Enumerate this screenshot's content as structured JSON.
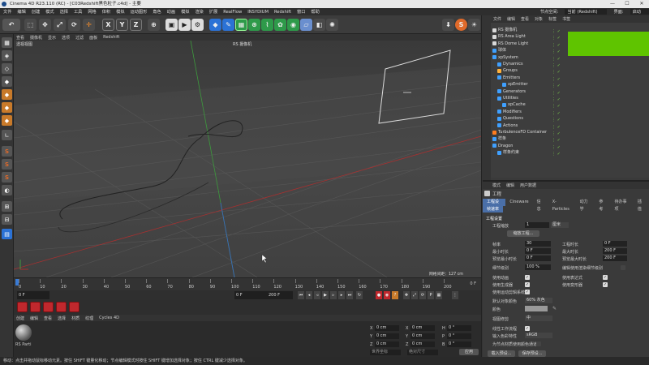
{
  "window": {
    "title": "Cinema 4D R23.110 (RC) - [C03Redshift黑色粒子.c4d] - 主要",
    "min": "—",
    "max": "☐",
    "close": "✕"
  },
  "menubar": {
    "items": [
      "文件",
      "编辑",
      "创建",
      "模式",
      "选择",
      "工具",
      "网格",
      "体积",
      "模拟",
      "运动图形",
      "角色",
      "动画",
      "模拟",
      "渲染",
      "扩展",
      "RealFlow",
      "INSYDIUM",
      "Redshift",
      "窗口",
      "帮助"
    ],
    "right": [
      "节点空间:",
      "当前 (Redshift)",
      "界面:",
      "启动"
    ]
  },
  "toolbar": {
    "xyz": [
      "X",
      "Y",
      "Z"
    ]
  },
  "viewport": {
    "menu": [
      "查看",
      "摄像机",
      "显示",
      "选项",
      "过滤",
      "面板",
      "Redshift"
    ],
    "label": "透视视图",
    "camera": "RS 摄像机",
    "grid": "网格间距：127 cm"
  },
  "timeline": {
    "ticks": [
      "0",
      "10",
      "20",
      "30",
      "40",
      "50",
      "60",
      "70",
      "80",
      "90",
      "100",
      "110",
      "120",
      "130",
      "140",
      "150",
      "160",
      "170",
      "180",
      "190",
      "200"
    ],
    "end_label": "0 F"
  },
  "transport": {
    "current": "0 F",
    "start": "0 F",
    "end": "200 F",
    "end2": "200 F"
  },
  "material": {
    "menu": [
      "创建",
      "编辑",
      "查看",
      "选择",
      "材质",
      "纹理",
      "Cycles 4D"
    ],
    "name": "RS Parti"
  },
  "coords": {
    "labels": [
      "X",
      "Y",
      "Z"
    ],
    "values": [
      "0 cm",
      "0 cm",
      "0 cm"
    ],
    "labels2": [
      "X",
      "Y",
      "Z"
    ],
    "values2": [
      "0 cm",
      "0 cm",
      "0 cm"
    ],
    "labels3": [
      "H",
      "P",
      "B"
    ],
    "values3": [
      "0 °",
      "0 °",
      "0 °"
    ],
    "mode1": "世界坐标",
    "mode2": "绝对尺寸",
    "apply": "应用"
  },
  "status": "移动：点击并拖动鼠标移动元素。按住 SHIFT 键量化移动；节点编辑模式时按住 SHIFT 键增加选择对象；按住 CTRL 键减少选择对象。",
  "object_manager": {
    "menu": [
      "文件",
      "编辑",
      "查看",
      "对象",
      "标签",
      "书签"
    ],
    "rows": [
      {
        "name": "RS 摄像机",
        "indent": 0,
        "color": "#d9d9d9"
      },
      {
        "name": "RS Area Light",
        "indent": 0,
        "color": "#d9d9d9"
      },
      {
        "name": "RS Dome Light",
        "indent": 0,
        "color": "#d9d9d9"
      },
      {
        "name": "球体",
        "indent": 0,
        "color": "#3fa0ff"
      },
      {
        "name": "xpSystem",
        "indent": 0,
        "color": "#3fa0ff"
      },
      {
        "name": "Dynamics",
        "indent": 1,
        "color": "#3fa0ff"
      },
      {
        "name": "Groups",
        "indent": 1,
        "color": "#ffb13b"
      },
      {
        "name": "Emitters",
        "indent": 1,
        "color": "#3fa0ff"
      },
      {
        "name": "xpEmitter",
        "indent": 2,
        "color": "#3fa0ff"
      },
      {
        "name": "Generators",
        "indent": 1,
        "color": "#3fa0ff"
      },
      {
        "name": "Utilities",
        "indent": 1,
        "color": "#3fa0ff"
      },
      {
        "name": "xpCache",
        "indent": 2,
        "color": "#3fa0ff"
      },
      {
        "name": "Modifiers",
        "indent": 1,
        "color": "#3fa0ff"
      },
      {
        "name": "Questions",
        "indent": 1,
        "color": "#3fa0ff"
      },
      {
        "name": "Actions",
        "indent": 1,
        "color": "#3fa0ff"
      },
      {
        "name": "TurbulenceFD Container",
        "indent": 0,
        "color": "#ff7d1f"
      },
      {
        "name": "样条",
        "indent": 0,
        "color": "#3fa0ff"
      },
      {
        "name": "Dragon",
        "indent": 0,
        "color": "#3fa0ff"
      },
      {
        "name": "样条约束",
        "indent": 1,
        "color": "#3fa0ff"
      }
    ]
  },
  "attributes": {
    "menu": [
      "模式",
      "编辑",
      "用户数据"
    ],
    "title": "工程",
    "tabs": [
      "工程设置",
      "Cineware",
      "信息",
      "X-Particles",
      "动力学",
      "参考",
      "待办事项",
      "插值"
    ],
    "tab2": "帧速率",
    "section": "工程设置",
    "scale_label": "工程缩放",
    "scale_value": "1",
    "scale_unit": "厘米",
    "scale_btn": "缩放工程...",
    "fields_left": [
      {
        "label": "帧率",
        "value": "30"
      },
      {
        "label": "最小时长",
        "value": "0 F"
      },
      {
        "label": "预览最小时长",
        "value": "0 F"
      },
      {
        "label": "细节级别",
        "value": "100 %"
      }
    ],
    "fields_right": [
      {
        "label": "工程时长",
        "value": "0 F"
      },
      {
        "label": "最大时长",
        "value": "200 F"
      },
      {
        "label": "预览最大时长",
        "value": "200 F"
      },
      {
        "label": "编辑使用渲染细节级别",
        "value": ""
      }
    ],
    "checks_left": [
      "使用动画",
      "使用生成器",
      "使用运动剪辑系统"
    ],
    "checks_right": [
      "使用表达式",
      "使用变形器"
    ],
    "default_color_label": "默认对象颜色",
    "default_color_value": "60% 灰色",
    "color_label": "颜色",
    "view_clip_label": "视图修剪",
    "view_clip_value": "中",
    "linear_label": "线性工作流程",
    "input_color_label": "输入色彩特性",
    "input_color_value": "sRGB",
    "node_label": "为节点材质使用颜色通道",
    "btn_load": "载入预设...",
    "btn_save": "保存预设..."
  },
  "colors": {
    "accent": "#4a6fa8",
    "key_red": "#c0282d",
    "green": "#5fc400"
  }
}
